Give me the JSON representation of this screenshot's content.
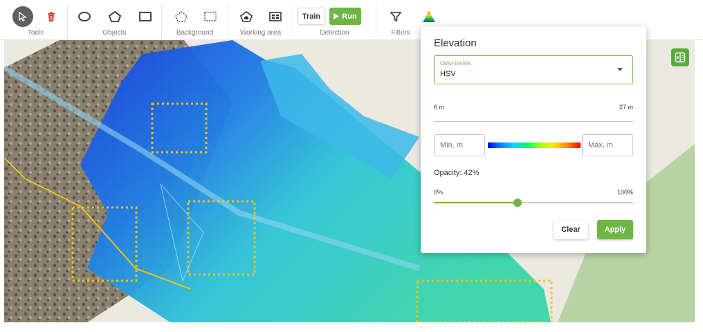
{
  "toolbar": {
    "groups": {
      "tools": "Tools",
      "objects": "Objects",
      "background": "Background",
      "working_area": "Working area",
      "detection": "Detection",
      "filters": "Filters"
    },
    "train_label": "Train",
    "run_label": "Run",
    "icons": [
      "cursor-icon",
      "trash-icon",
      "ellipse-icon",
      "pentagon-icon",
      "rectangle-icon",
      "dashed-pentagon-icon",
      "dashed-rectangle-icon",
      "home-area-icon",
      "area-grid-icon",
      "funnel-icon",
      "elevation-triangle-icon"
    ]
  },
  "elevation_panel": {
    "title": "Elevation",
    "color_theme": {
      "label": "Color theme",
      "value": "HSV"
    },
    "range": {
      "min_label": "6 m",
      "max_label": "27 m"
    },
    "min_placeholder": "Min, m",
    "max_placeholder": "Max, m",
    "opacity": {
      "label": "Opacity: 42%",
      "value_percent": 42,
      "min_label": "0%",
      "max_label": "100%"
    },
    "clear_label": "Clear",
    "apply_label": "Apply"
  },
  "colors": {
    "accent": "#6eb543",
    "detection_box": "#f2c418"
  }
}
